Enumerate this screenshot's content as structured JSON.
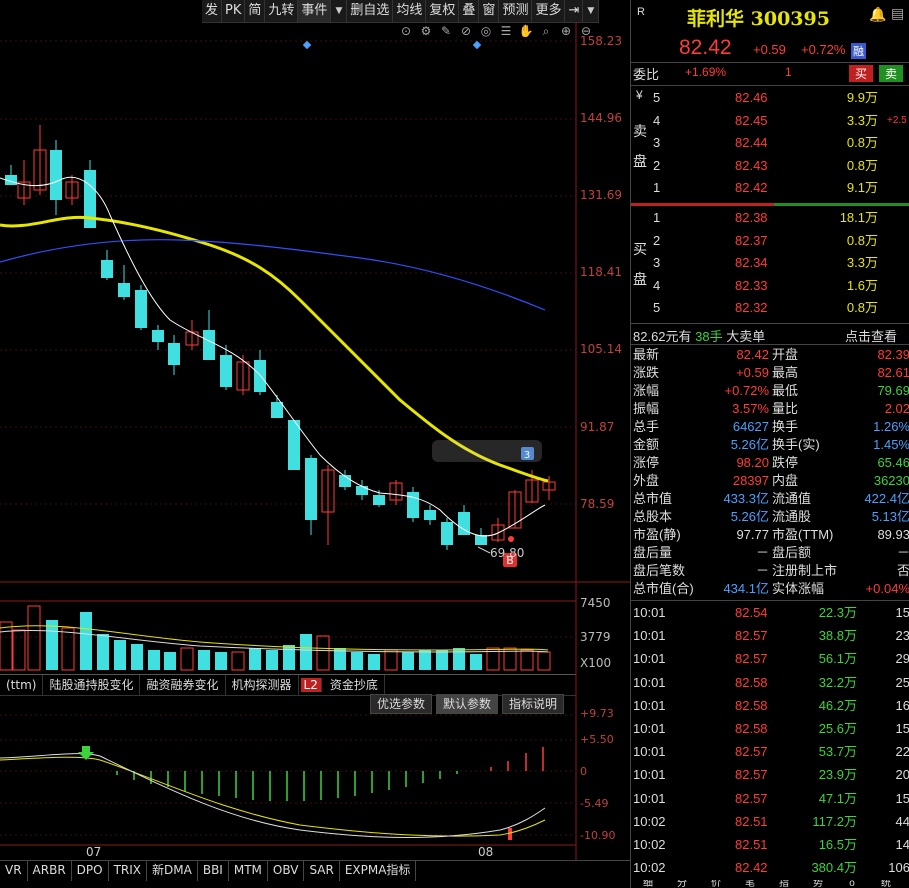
{
  "toolbar": {
    "items": [
      "发",
      "PK",
      "简",
      "九转",
      "事件",
      "▼",
      "删自选",
      "均线",
      "复权",
      "叠",
      "窗",
      "预测",
      "更多",
      "⇥",
      "▼"
    ]
  },
  "chart_icons": [
    "⊙",
    "⚙",
    "✎",
    "⊘",
    "◎",
    "☰",
    "✋",
    "⌕",
    "⊕",
    "⊖"
  ],
  "price_axis": [
    "158.23",
    "144.96",
    "131.69",
    "118.41",
    "105.14",
    "91.87",
    "78.59"
  ],
  "volume_axis": [
    "7450",
    "3779",
    "X100"
  ],
  "indicator_axis": [
    "+9.73",
    "+5.50",
    "0",
    "-5.49",
    "-10.90"
  ],
  "low_marker": "69.80",
  "badge_b": "B",
  "badge_3": "3",
  "x_labels": [
    "07",
    "08"
  ],
  "tabs": [
    "(ttm)",
    "陆股通持股变化",
    "融资融券变化",
    "机构探测器",
    "L2",
    "资金抄底"
  ],
  "indicator_buttons": [
    "优选参数",
    "默认参数",
    "指标说明"
  ],
  "bottom_tabs": [
    "VR",
    "ARBR",
    "DPO",
    "TRIX",
    "新DMA",
    "BBI",
    "MTM",
    "OBV",
    "SAR",
    "EXPMA指标"
  ],
  "stock": {
    "r_label": "R",
    "name": "菲利华",
    "code": "300395",
    "price": "82.42",
    "change": "+0.59",
    "pct": "+0.72%",
    "tag": "融",
    "weibi_label": "委比",
    "weibi": "+1.69%",
    "weicha": "1",
    "buy_btn": "买",
    "sell_btn": "卖"
  },
  "sell_label": [
    "卖",
    "盘"
  ],
  "buy_label": [
    "买",
    "盘"
  ],
  "yen": "¥",
  "asks": [
    {
      "lvl": "5",
      "price": "82.46",
      "vol": "9.9",
      "unit": "万"
    },
    {
      "lvl": "4",
      "price": "82.45",
      "vol": "3.3",
      "unit": "万",
      "extra": "+2.5"
    },
    {
      "lvl": "3",
      "price": "82.44",
      "vol": "0.8",
      "unit": "万"
    },
    {
      "lvl": "2",
      "price": "82.43",
      "vol": "0.8",
      "unit": "万"
    },
    {
      "lvl": "1",
      "price": "82.42",
      "vol": "9.1",
      "unit": "万"
    }
  ],
  "bids": [
    {
      "lvl": "1",
      "price": "82.38",
      "vol": "18.1",
      "unit": "万"
    },
    {
      "lvl": "2",
      "price": "82.37",
      "vol": "0.8",
      "unit": "万"
    },
    {
      "lvl": "3",
      "price": "82.34",
      "vol": "3.3",
      "unit": "万"
    },
    {
      "lvl": "4",
      "price": "82.33",
      "vol": "1.6",
      "unit": "万"
    },
    {
      "lvl": "5",
      "price": "82.32",
      "vol": "0.8",
      "unit": "万"
    }
  ],
  "big_order": {
    "price": "82.62元有",
    "hands": "38手",
    "label": "大卖单",
    "link": "点击查看"
  },
  "quote": [
    [
      "最新",
      "82.42",
      "开盘",
      "82.39"
    ],
    [
      "涨跌",
      "+0.59",
      "最高",
      "82.61"
    ],
    [
      "涨幅",
      "+0.72%",
      "最低",
      "79.69"
    ],
    [
      "振幅",
      "3.57%",
      "量比",
      "2.02"
    ],
    [
      "总手",
      "64627",
      "换手",
      "1.26%"
    ],
    [
      "金额",
      "5.26亿",
      "换手(实)",
      "1.45%"
    ],
    [
      "涨停",
      "98.20",
      "跌停",
      "65.46"
    ],
    [
      "外盘",
      "28397",
      "内盘",
      "36230"
    ],
    [
      "总市值",
      "433.3亿",
      "流通值",
      "422.4亿"
    ],
    [
      "总股本",
      "5.26亿",
      "流通股",
      "5.13亿"
    ],
    [
      "市盈(静)",
      "97.77",
      "市盈(TTM)",
      "89.93"
    ],
    [
      "盘后量",
      "－",
      "盘后额",
      "－"
    ],
    [
      "盘后笔数",
      "－",
      "注册制上市",
      "否"
    ],
    [
      "总市值(合)",
      "434.1亿",
      "实体涨幅",
      "+0.04%"
    ]
  ],
  "ticks": [
    {
      "time": "10:01",
      "price": "82.54",
      "vol": "22.3万",
      "n": "15"
    },
    {
      "time": "10:01",
      "price": "82.57",
      "vol": "38.8万",
      "n": "23"
    },
    {
      "time": "10:01",
      "price": "82.57",
      "vol": "56.1万",
      "n": "29"
    },
    {
      "time": "10:01",
      "price": "82.58",
      "vol": "32.2万",
      "n": "25"
    },
    {
      "time": "10:01",
      "price": "82.58",
      "vol": "46.2万",
      "n": "16"
    },
    {
      "time": "10:01",
      "price": "82.58",
      "vol": "25.6万",
      "n": "15"
    },
    {
      "time": "10:01",
      "price": "82.57",
      "vol": "53.7万",
      "n": "22"
    },
    {
      "time": "10:01",
      "price": "82.57",
      "vol": "23.9万",
      "n": "20"
    },
    {
      "time": "10:01",
      "price": "82.57",
      "vol": "47.1万",
      "n": "15"
    },
    {
      "time": "10:02",
      "price": "82.51",
      "vol": "117.2万",
      "n": "44"
    },
    {
      "time": "10:02",
      "price": "82.51",
      "vol": "16.5万",
      "n": "14"
    },
    {
      "time": "10:02",
      "price": "82.42",
      "vol": "380.4万",
      "n": "106"
    }
  ],
  "bottom_right_tabs": [
    "细",
    "分",
    "价",
    "笔",
    "指",
    "势",
    "ο",
    "统"
  ],
  "colors": {
    "up": "#ff3b3b",
    "down": "#40e0e0",
    "ma5": "#ffffff",
    "ma10": "#e6e600",
    "ma20": "#3050ff"
  }
}
